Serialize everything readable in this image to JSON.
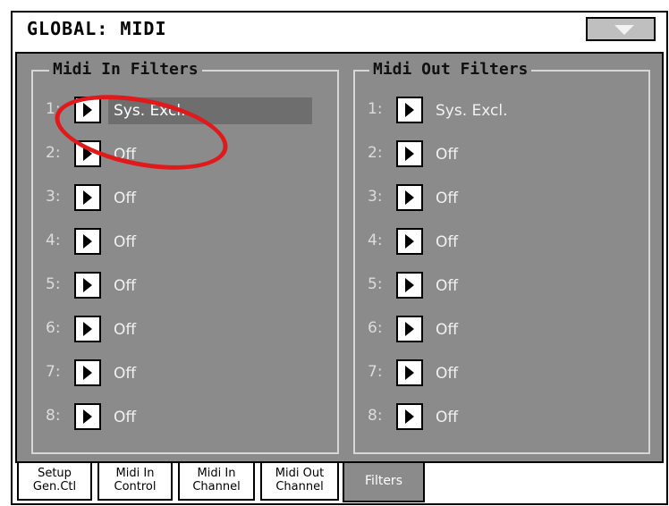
{
  "window": {
    "title": "GLOBAL: MIDI"
  },
  "panels": {
    "midi_in": {
      "title": "Midi In Filters",
      "rows": [
        {
          "num": "1:",
          "value": "Sys. Excl."
        },
        {
          "num": "2:",
          "value": "Off"
        },
        {
          "num": "3:",
          "value": "Off"
        },
        {
          "num": "4:",
          "value": "Off"
        },
        {
          "num": "5:",
          "value": "Off"
        },
        {
          "num": "6:",
          "value": "Off"
        },
        {
          "num": "7:",
          "value": "Off"
        },
        {
          "num": "8:",
          "value": "Off"
        }
      ]
    },
    "midi_out": {
      "title": "Midi Out Filters",
      "rows": [
        {
          "num": "1:",
          "value": "Sys. Excl."
        },
        {
          "num": "2:",
          "value": "Off"
        },
        {
          "num": "3:",
          "value": "Off"
        },
        {
          "num": "4:",
          "value": "Off"
        },
        {
          "num": "5:",
          "value": "Off"
        },
        {
          "num": "6:",
          "value": "Off"
        },
        {
          "num": "7:",
          "value": "Off"
        },
        {
          "num": "8:",
          "value": "Off"
        }
      ]
    }
  },
  "tabs": [
    {
      "line1": "Setup",
      "line2": "Gen.Ctl"
    },
    {
      "line1": "Midi In",
      "line2": "Control"
    },
    {
      "line1": "Midi In",
      "line2": "Channel"
    },
    {
      "line1": "Midi Out",
      "line2": "Channel"
    },
    {
      "line1": "Filters",
      "line2": ""
    }
  ],
  "colors": {
    "panel_bg": "#8b8b8b",
    "highlight": "#e0191b",
    "selected_bg": "#6e6e6e"
  }
}
